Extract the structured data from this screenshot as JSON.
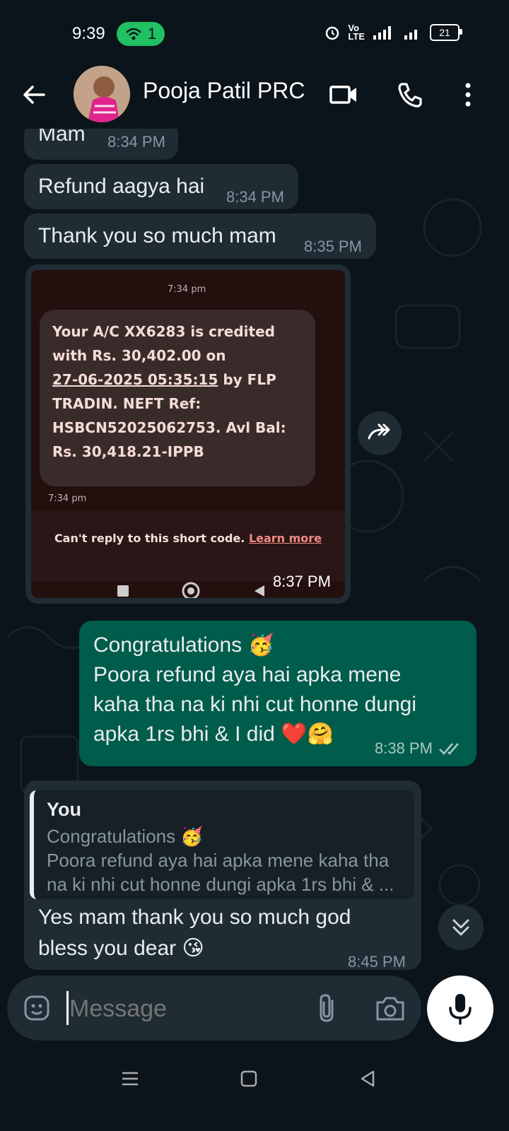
{
  "status": {
    "time": "9:39",
    "hotspot_count": "1",
    "battery": "21"
  },
  "chat_header": {
    "contact_name": "Pooja Patil PRC"
  },
  "messages": [
    {
      "text": "Mam",
      "time": "8:34 PM"
    },
    {
      "text": "Refund aagya hai",
      "time": "8:34 PM"
    },
    {
      "text": "Thank you so much mam",
      "time": "8:35 PM"
    },
    {
      "image_time": "8:37 PM"
    },
    {
      "line1": "Congratulations 🥳",
      "line2": "Poora refund aya hai apka mene",
      "line3": "kaha tha na ki nhi cut honne dungi",
      "line4": "apka 1rs bhi & I did ❤️🤗",
      "time": "8:38 PM"
    },
    {
      "reply_author": "You",
      "reply_line1": "Congratulations 🥳",
      "reply_line2": "Poora refund aya hai apka mene kaha tha",
      "reply_line3": "na ki nhi cut honne dungi apka 1rs bhi & ...",
      "line1": "Yes mam thank you so much god",
      "line2": "bless you dear 😘",
      "time": "8:45 PM"
    }
  ],
  "screenshot": {
    "time_top": "7:34 pm",
    "sms_line1": "Your A/C XX6283 is credited",
    "sms_line2": "with Rs. 30,402.00 on",
    "sms_date": "27-06-2025 05:35:15",
    "sms_line3_tail": " by FLP",
    "sms_line4": "TRADIN. NEFT Ref:",
    "sms_line5": "HSBCN52025062753. Avl Bal:",
    "sms_line6": "Rs. 30,418.21-IPPB",
    "time_bottom": "7:34 pm",
    "cant_reply": "Can't reply to this short code. ",
    "learn_more": "Learn more"
  },
  "input": {
    "placeholder": "Message"
  },
  "colors": {
    "incoming_bubble": "#1f2c34",
    "outgoing_bubble": "#005c4b",
    "hotspot": "#21c063",
    "read_ticks": "#8696a0"
  }
}
